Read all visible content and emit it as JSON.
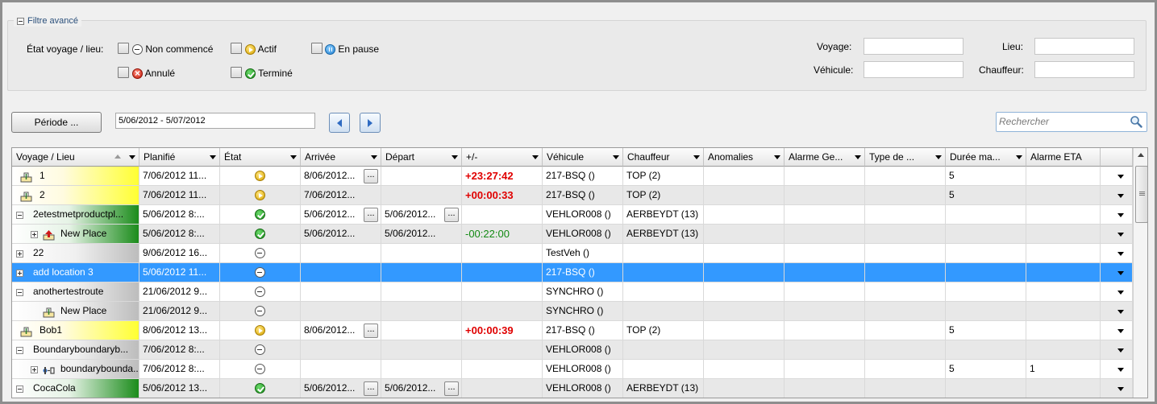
{
  "filter": {
    "legend": "Filtre avancé",
    "state_label": "État voyage / lieu:",
    "states": [
      {
        "label": "Non commencé",
        "icon": "not-started-icon"
      },
      {
        "label": "Actif",
        "icon": "active-icon"
      },
      {
        "label": "En pause",
        "icon": "paused-icon"
      },
      {
        "label": "Annulé",
        "icon": "cancelled-icon"
      },
      {
        "label": "Terminé",
        "icon": "finished-icon"
      }
    ],
    "voyage_label": "Voyage:",
    "lieu_label": "Lieu:",
    "vehicule_label": "Véhicule:",
    "chauffeur_label": "Chauffeur:"
  },
  "toolbar": {
    "periode_label": "Période ...",
    "date_range": "5/06/2012 - 5/07/2012",
    "search_placeholder": "Rechercher"
  },
  "grid": {
    "columns": [
      "Voyage / Lieu",
      "Planifié",
      "État",
      "Arrivée",
      "Départ",
      "+/-",
      "Véhicule",
      "Chauffeur",
      "Anomalies",
      "Alarme Ge...",
      "Type de ...",
      "Durée ma...",
      "Alarme ETA"
    ],
    "rows": [
      {
        "name": "1",
        "planifie": "7/06/2012 11...",
        "etat": "actif",
        "arrivee": "8/06/2012...",
        "arr_btn": true,
        "depart": "",
        "dep_btn": false,
        "delta": "+23:27:42",
        "delta_style": "red",
        "vehicule": "217-BSQ ()",
        "chauffeur": "TOP (2)",
        "duree": "5",
        "eta": ""
      },
      {
        "name": "2",
        "planifie": "7/06/2012 11...",
        "etat": "actif",
        "arrivee": "7/06/2012...",
        "arr_btn": false,
        "depart": "",
        "dep_btn": false,
        "delta": "+00:00:33",
        "delta_style": "red",
        "vehicule": "217-BSQ ()",
        "chauffeur": "TOP (2)",
        "duree": "5",
        "eta": ""
      },
      {
        "name": "2etestmetproductpl...",
        "planifie": "5/06/2012 8:...",
        "etat": "termine",
        "arrivee": "5/06/2012...",
        "arr_btn": true,
        "depart": "5/06/2012...",
        "dep_btn": true,
        "delta": "",
        "delta_style": "",
        "vehicule": "VEHLOR008 ()",
        "chauffeur": "AERBEYDT (13)",
        "duree": "",
        "eta": ""
      },
      {
        "name": "New Place",
        "planifie": "5/06/2012 8:...",
        "etat": "termine",
        "arrivee": "5/06/2012...",
        "arr_btn": false,
        "depart": "5/06/2012...",
        "dep_btn": false,
        "delta": "-00:22:00",
        "delta_style": "green",
        "vehicule": "VEHLOR008 ()",
        "chauffeur": "AERBEYDT (13)",
        "duree": "",
        "eta": ""
      },
      {
        "name": "22",
        "planifie": "9/06/2012 16...",
        "etat": "noncom",
        "arrivee": "",
        "arr_btn": false,
        "depart": "",
        "dep_btn": false,
        "delta": "",
        "delta_style": "",
        "vehicule": "TestVeh ()",
        "chauffeur": "",
        "duree": "",
        "eta": ""
      },
      {
        "name": "add location 3",
        "planifie": "5/06/2012 11...",
        "etat": "noncom",
        "arrivee": "",
        "arr_btn": false,
        "depart": "",
        "dep_btn": false,
        "delta": "",
        "delta_style": "",
        "vehicule": "217-BSQ ()",
        "chauffeur": "",
        "duree": "",
        "eta": ""
      },
      {
        "name": "anothertestroute",
        "planifie": "21/06/2012 9...",
        "etat": "noncom",
        "arrivee": "",
        "arr_btn": false,
        "depart": "",
        "dep_btn": false,
        "delta": "",
        "delta_style": "",
        "vehicule": "SYNCHRO ()",
        "chauffeur": "",
        "duree": "",
        "eta": ""
      },
      {
        "name": "New Place",
        "planifie": "21/06/2012 9...",
        "etat": "noncom",
        "arrivee": "",
        "arr_btn": false,
        "depart": "",
        "dep_btn": false,
        "delta": "",
        "delta_style": "",
        "vehicule": "SYNCHRO ()",
        "chauffeur": "",
        "duree": "",
        "eta": ""
      },
      {
        "name": "Bob1",
        "planifie": "8/06/2012 13...",
        "etat": "actif",
        "arrivee": "8/06/2012...",
        "arr_btn": true,
        "depart": "",
        "dep_btn": false,
        "delta": "+00:00:39",
        "delta_style": "red",
        "vehicule": "217-BSQ ()",
        "chauffeur": "TOP (2)",
        "duree": "5",
        "eta": ""
      },
      {
        "name": "Boundaryboundaryb...",
        "planifie": "7/06/2012 8:...",
        "etat": "noncom",
        "arrivee": "",
        "arr_btn": false,
        "depart": "",
        "dep_btn": false,
        "delta": "",
        "delta_style": "",
        "vehicule": "VEHLOR008 ()",
        "chauffeur": "",
        "duree": "",
        "eta": ""
      },
      {
        "name": "boundarybounda...",
        "planifie": "7/06/2012 8:...",
        "etat": "noncom",
        "arrivee": "",
        "arr_btn": false,
        "depart": "",
        "dep_btn": false,
        "delta": "",
        "delta_style": "",
        "vehicule": "VEHLOR008 ()",
        "chauffeur": "",
        "duree": "5",
        "eta": "1"
      },
      {
        "name": "CocaCola",
        "planifie": "5/06/2012 13...",
        "etat": "termine",
        "arrivee": "5/06/2012...",
        "arr_btn": true,
        "depart": "5/06/2012...",
        "dep_btn": true,
        "delta": "",
        "delta_style": "",
        "vehicule": "VEHLOR008 ()",
        "chauffeur": "AERBEYDT (13)",
        "duree": "",
        "eta": ""
      }
    ]
  },
  "colors": {
    "selection": "#3399ff",
    "late": "#e00000",
    "early": "#138a13",
    "trip_yellow": "#ffff33",
    "trip_green": "#1b8c1b"
  }
}
